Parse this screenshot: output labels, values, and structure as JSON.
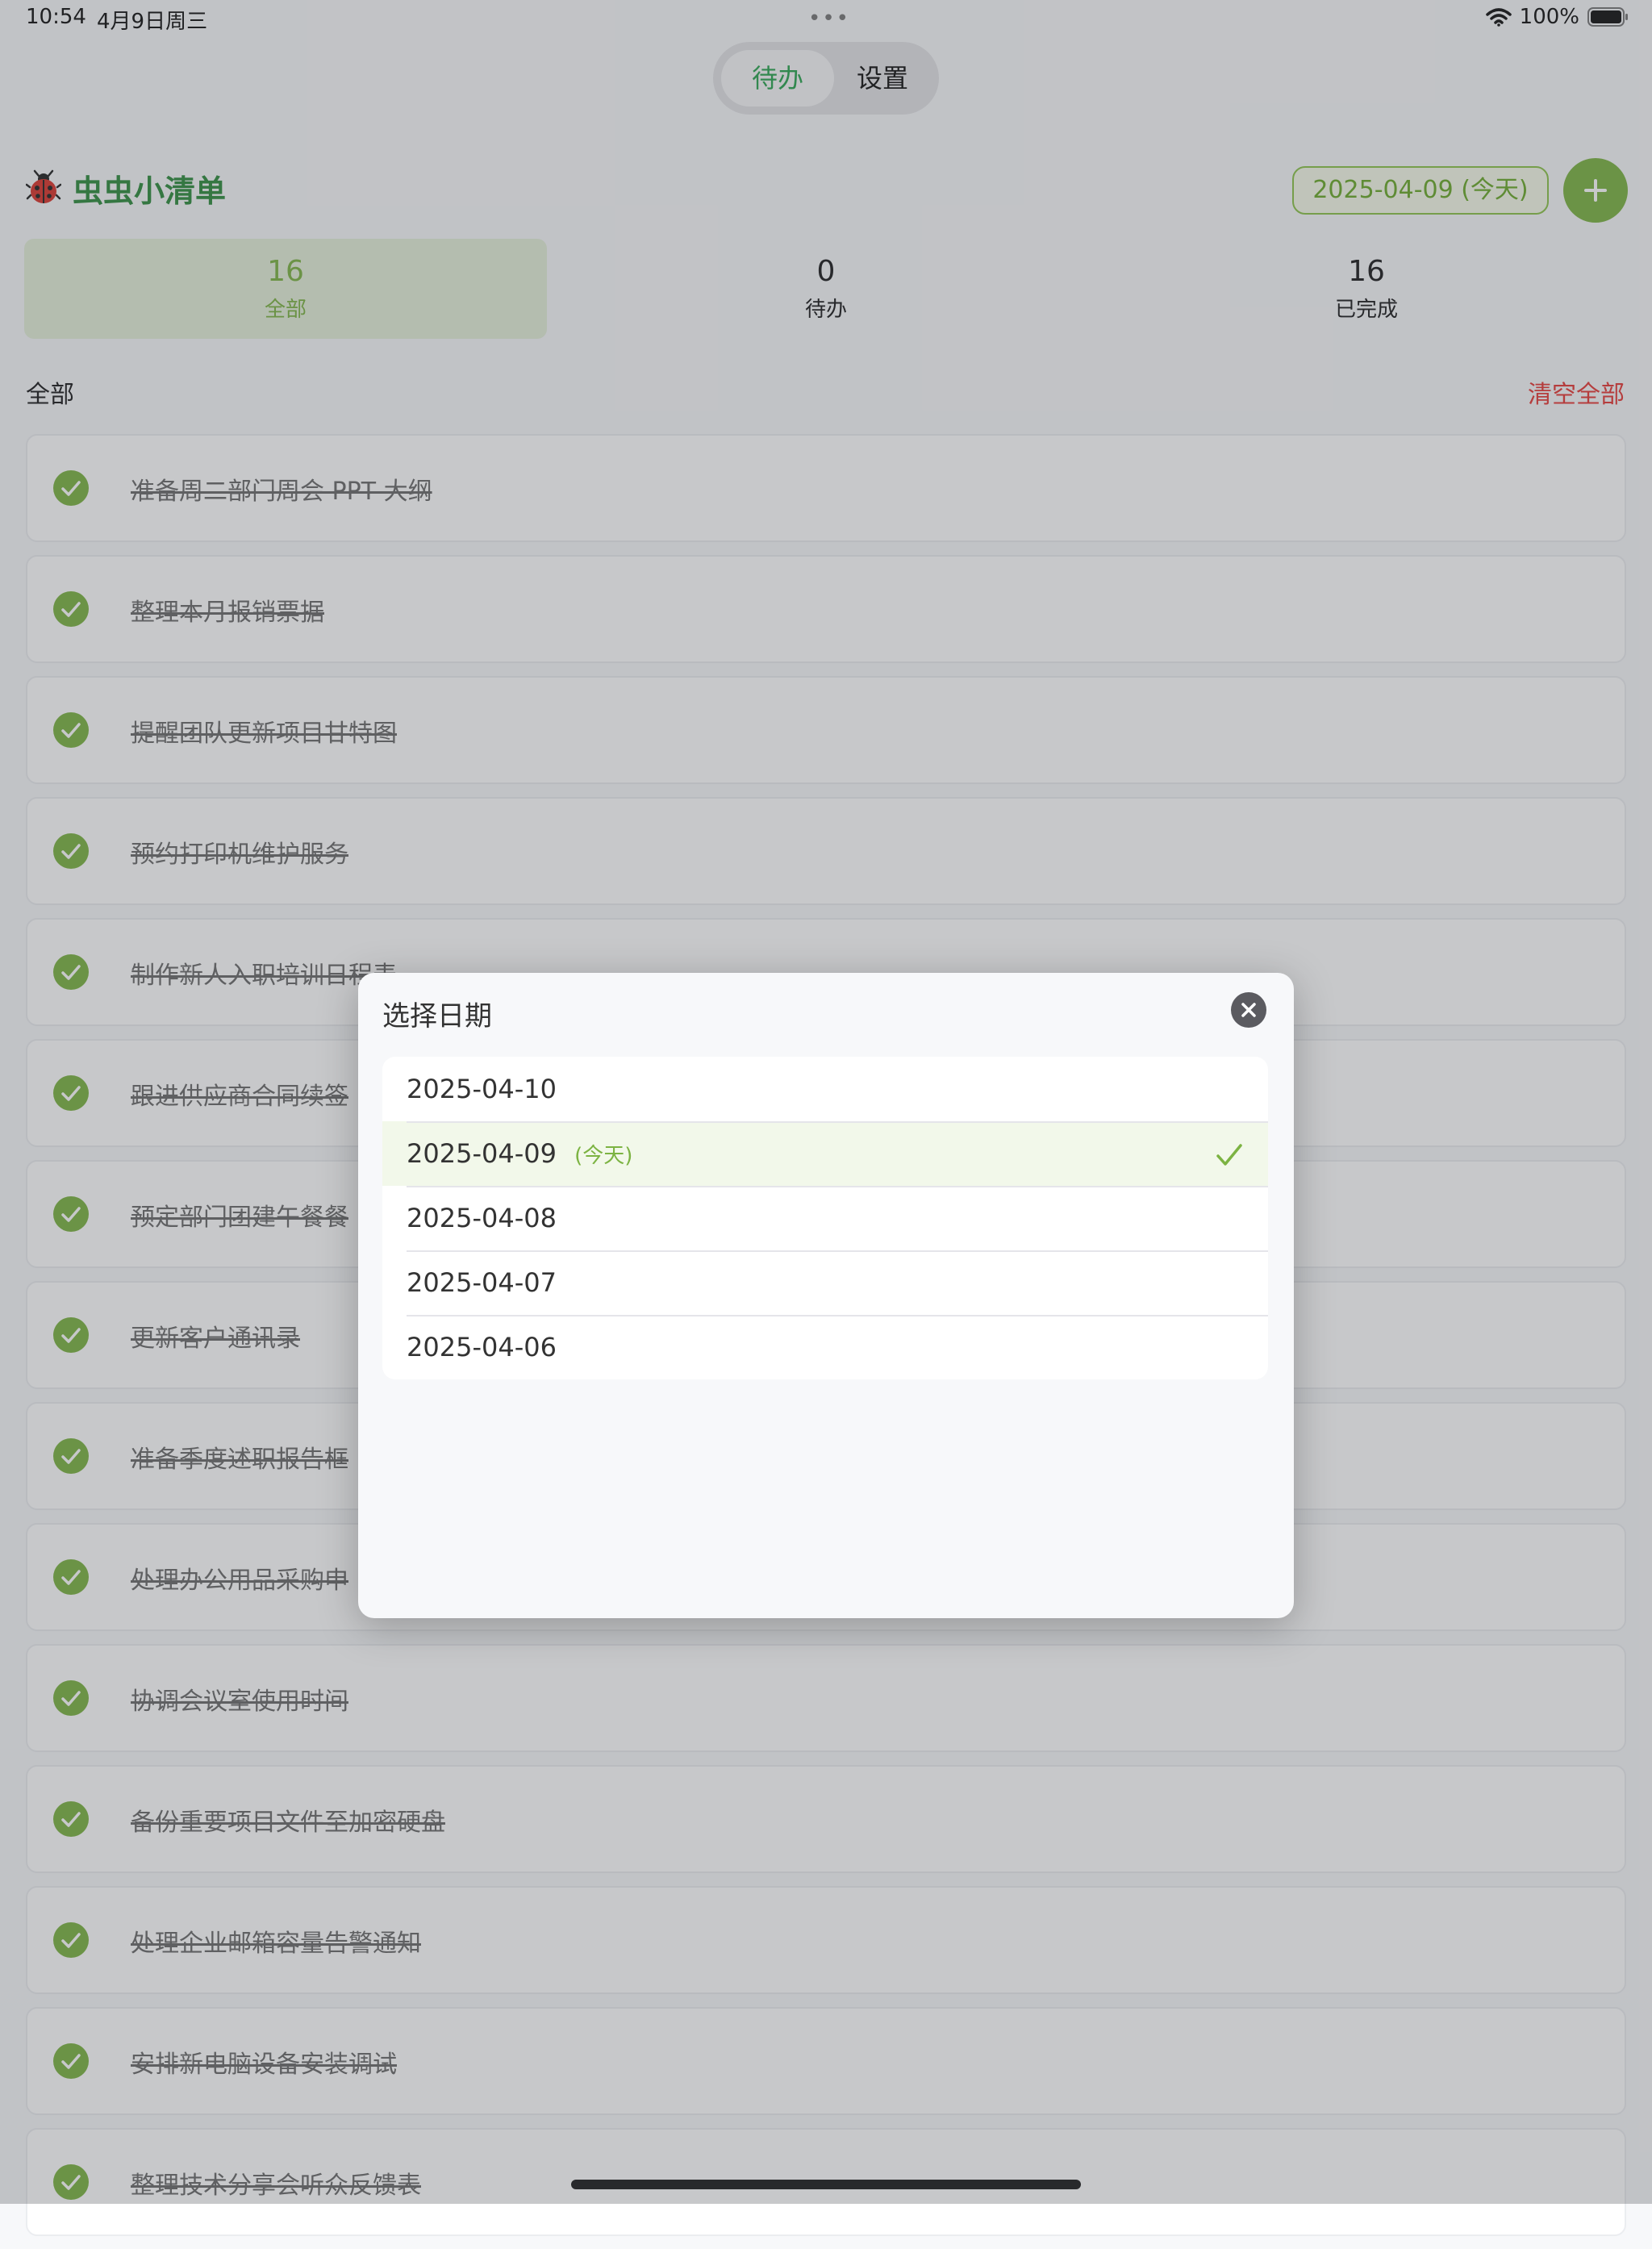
{
  "status_bar": {
    "time": "10:54",
    "date": "4月9日周三",
    "dots": "•••",
    "battery": "100%"
  },
  "segment": {
    "tabs": [
      {
        "label": "待办",
        "active": true
      },
      {
        "label": "设置",
        "active": false
      }
    ]
  },
  "header": {
    "app_title": "虫虫小清单",
    "date_chip": "2025-04-09 (今天)",
    "add_label": "+"
  },
  "stats": [
    {
      "count": "16",
      "label": "全部",
      "active": true
    },
    {
      "count": "0",
      "label": "待办",
      "active": false
    },
    {
      "count": "16",
      "label": "已完成",
      "active": false
    }
  ],
  "list_header": {
    "title": "全部",
    "clear_label": "清空全部"
  },
  "todos": [
    {
      "text": "准备周二部门周会 PPT 大纲",
      "done": true
    },
    {
      "text": "整理本月报销票据",
      "done": true
    },
    {
      "text": "提醒团队更新项目甘特图",
      "done": true
    },
    {
      "text": "预约打印机维护服务",
      "done": true
    },
    {
      "text": "制作新人入职培训日程表",
      "done": true
    },
    {
      "text": "跟进供应商合同续签",
      "done": true
    },
    {
      "text": "预定部门团建午餐餐",
      "done": true
    },
    {
      "text": "更新客户通讯录",
      "done": true
    },
    {
      "text": "准备季度述职报告框",
      "done": true
    },
    {
      "text": "处理办公用品采购申",
      "done": true
    },
    {
      "text": "协调会议室使用时间",
      "done": true
    },
    {
      "text": "备份重要项目文件至加密硬盘",
      "done": true
    },
    {
      "text": "处理企业邮箱容量告警通知",
      "done": true
    },
    {
      "text": "安排新电脑设备安装调试",
      "done": true
    },
    {
      "text": "整理技术分享会听众反馈表",
      "done": true
    }
  ],
  "date_modal": {
    "title": "选择日期",
    "close_icon": "close-icon",
    "today_label": "(今天)",
    "dates": [
      {
        "date": "2025-04-10",
        "today": false,
        "selected": false
      },
      {
        "date": "2025-04-09",
        "today": true,
        "selected": true
      },
      {
        "date": "2025-04-08",
        "today": false,
        "selected": false
      },
      {
        "date": "2025-04-07",
        "today": false,
        "selected": false
      },
      {
        "date": "2025-04-06",
        "today": false,
        "selected": false
      }
    ]
  },
  "colors": {
    "brand_green": "#2e8b3d",
    "accent_green": "#7cb342",
    "danger_red": "#e53935"
  }
}
